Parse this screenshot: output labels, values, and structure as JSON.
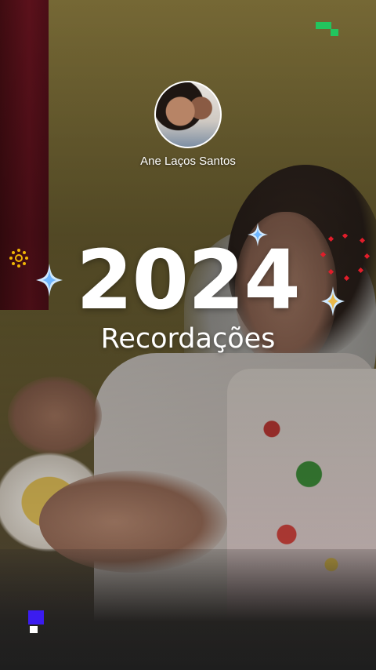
{
  "profile": {
    "name": "Ane Laços Santos",
    "avatar_icon": "profile-photo"
  },
  "card": {
    "year": "2024",
    "subtitle": "Recordações"
  },
  "decorations": {
    "top_right_icon": "green-pixel-squares-icon",
    "bottom_left_icon": "blue-pixel-squares-icon",
    "accent_colors": {
      "brand_green": "#22c55e",
      "brand_blue": "#3b1cf0",
      "sun_yellow": "#f2b705",
      "dots_red": "#e11d2a",
      "sparkle_blue": "#9fd3ff"
    }
  }
}
